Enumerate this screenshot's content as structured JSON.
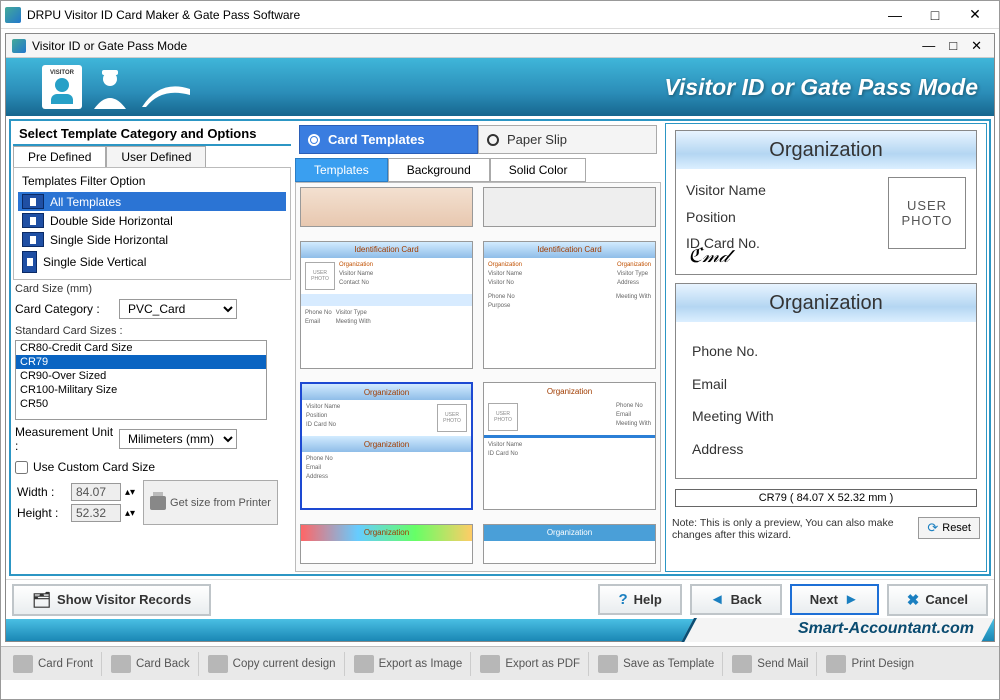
{
  "outerTitle": "DRPU Visitor ID Card Maker & Gate Pass Software",
  "innerTitle": "Visitor ID or Gate Pass Mode",
  "bannerTitle": "Visitor ID or Gate Pass Mode",
  "leftPanel": {
    "sectionTitle": "Select Template Category and Options",
    "tabs": {
      "preDefined": "Pre Defined",
      "userDefined": "User Defined",
      "active": "preDefined"
    },
    "filterTitle": "Templates Filter Option",
    "filters": {
      "all": "All Templates",
      "dsh": "Double Side Horizontal",
      "ssh": "Single Side Horizontal",
      "ssv": "Single Side Vertical",
      "selected": "all"
    },
    "cardSizeLabel": "Card Size (mm)",
    "cardCategoryLabel": "Card Category :",
    "cardCategoryValue": "PVC_Card",
    "standardSizesLabel": "Standard Card Sizes :",
    "sizes": {
      "s1": "CR80-Credit Card Size",
      "s2": "CR79",
      "s3": "CR90-Over Sized",
      "s4": "CR100-Military Size",
      "s5": "CR50",
      "selected": "s2"
    },
    "measurementUnitLabel": "Measurement Unit :",
    "measurementUnitValue": "Milimeters (mm)",
    "useCustomLabel": "Use Custom Card Size",
    "widthLabel": "Width :",
    "widthValue": "84.07",
    "heightLabel": "Height :",
    "heightValue": "52.32",
    "printerBtn": "Get size from Printer"
  },
  "midPanel": {
    "modeCardTemplates": "Card Templates",
    "modePaperSlip": "Paper Slip",
    "subTemplates": "Templates",
    "subBackground": "Background",
    "subSolidColor": "Solid Color"
  },
  "preview": {
    "orgTitle": "Organization",
    "visitorName": "Visitor Name",
    "position": "Position",
    "idCardNo": "ID Card No.",
    "userPhoto": "USER PHOTO",
    "phone": "Phone No.",
    "email": "Email",
    "meetingWith": "Meeting With",
    "address": "Address",
    "sizeLabel": "CR79 ( 84.07 X 52.32 mm )",
    "note": "Note: This is only a preview, You can also make changes after this wizard.",
    "reset": "Reset"
  },
  "wizard": {
    "showVisitorRecords": "Show Visitor Records",
    "help": "Help",
    "back": "Back",
    "next": "Next",
    "cancel": "Cancel"
  },
  "brand": "Smart-Accountant.com",
  "toolbar": {
    "cardFront": "Card Front",
    "cardBack": "Card Back",
    "copyDesign": "Copy current design",
    "exportImage": "Export as Image",
    "exportPdf": "Export as PDF",
    "saveTemplate": "Save as Template",
    "sendMail": "Send Mail",
    "printDesign": "Print Design"
  }
}
